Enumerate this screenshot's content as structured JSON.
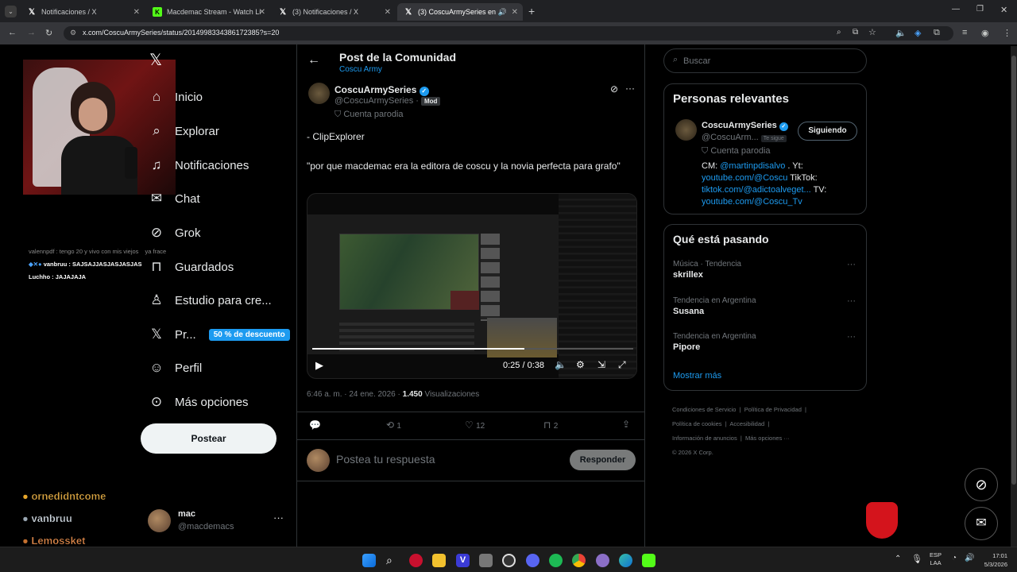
{
  "browser": {
    "tabs": [
      {
        "title": "Notificaciones / X"
      },
      {
        "title": "Macdemac Stream - Watch Live"
      },
      {
        "title": "(3) Notificaciones / X"
      },
      {
        "title": "(3) CoscuArmySeries en X: \""
      }
    ],
    "url": "x.com/CoscuArmySeries/status/2014998334386172385?s=20"
  },
  "stream_overlay": {
    "chat": [
      {
        "user": "valennpdf",
        "text": ": tengo 20 y vivo con mis viejos",
        "extra": "ya frace"
      },
      {
        "user": "vanbruu",
        "text": ": SAJSAJJASJASJASJAS"
      },
      {
        "user": "Luchho",
        "text": ": JAJAJAJA"
      }
    ],
    "names": [
      "ornedidntcome",
      "vanbruu",
      "Lemossket"
    ]
  },
  "nav": {
    "items": [
      {
        "label": "Inicio"
      },
      {
        "label": "Explorar"
      },
      {
        "label": "Notificaciones"
      },
      {
        "label": "Chat"
      },
      {
        "label": "Grok"
      },
      {
        "label": "Guardados"
      },
      {
        "label": "Estudio para cre..."
      },
      {
        "label": "Pr...",
        "badge": "50 % de descuento"
      },
      {
        "label": "Perfil"
      },
      {
        "label": "Más opciones"
      }
    ],
    "post_label": "Postear",
    "account": {
      "name": "mac",
      "handle": "@macdemacs"
    }
  },
  "post": {
    "header_title": "Post de la Comunidad",
    "community": "Coscu Army",
    "author": {
      "name": "CoscuArmySeries",
      "handle": "@CoscuArmySeries",
      "role": "Mod",
      "label": "Cuenta parodia"
    },
    "text1": "- ClipExplorer",
    "text2": "\"por que macdemac era la editora de coscu y la novia perfecta para grafo\"",
    "video": {
      "time": "0:25 / 0:38",
      "progress": 0.66
    },
    "timestamp": "6:46 a. m. · 24 ene. 2026 · ",
    "views": "1.450",
    "views_label": " Visualizaciones",
    "stats": {
      "replies": "",
      "reposts": "1",
      "likes": "12",
      "bookmarks": "2"
    },
    "reply_placeholder": "Postea tu respuesta",
    "reply_button": "Responder"
  },
  "sidebar": {
    "search_placeholder": "Buscar",
    "relevant_title": "Personas relevantes",
    "person": {
      "name": "CoscuArmySeries",
      "handle": "@CoscuArm...",
      "follows_you": "Te sigue",
      "button": "Siguiendo",
      "label": "Cuenta parodia",
      "bio_cm": "CM: ",
      "bio_cm_link": "@martinpdisalvo",
      "bio_yt": " . Yt: ",
      "bio_link1": "youtube.com/@Coscu",
      "bio_tiktok": " TikTok: ",
      "bio_link2": "tiktok.com/@adictoalveget...",
      "bio_tv": " TV: ",
      "bio_link3": "youtube.com/@Coscu_Tv"
    },
    "trending_title": "Qué está pasando",
    "trends": [
      {
        "category": "Música · Tendencia",
        "name": "skrillex"
      },
      {
        "category": "Tendencia en Argentina",
        "name": "Susana"
      },
      {
        "category": "Tendencia en Argentina",
        "name": "Pipore"
      }
    ],
    "show_more": "Mostrar más",
    "footer": {
      "l1": "Condiciones de Servicio",
      "l2": "Política de Privacidad",
      "l3": "Política de cookies",
      "l4": "Accesibilidad",
      "l5": "Información de anuncios",
      "l6": "Más opciones ···",
      "copyright": "© 2026 X Corp."
    }
  },
  "taskbar": {
    "lang": "ESP",
    "lang2": "LAA",
    "time": "17:01",
    "date": "5/3/2026"
  },
  "colors": {
    "accent": "#1d9bf0",
    "background": "#000000",
    "border": "#2f3336"
  }
}
